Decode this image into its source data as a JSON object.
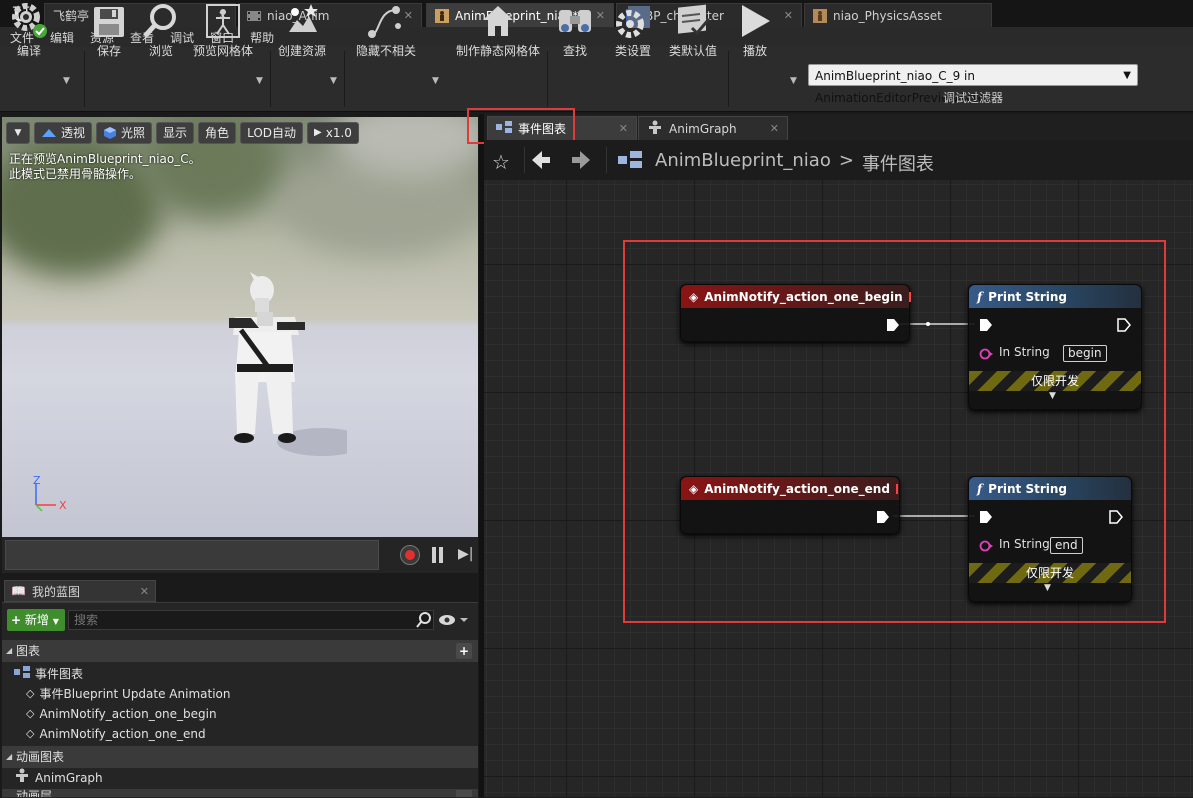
{
  "window_tabs": [
    {
      "label": "飞鹤亭"
    },
    {
      "label": "niao_Anim"
    },
    {
      "label": "AnimBlueprint_niao*"
    },
    {
      "label": "BP_character"
    },
    {
      "label": "niao_PhysicsAsset"
    }
  ],
  "menu": [
    "文件",
    "编辑",
    "资源",
    "查看",
    "调试",
    "窗口",
    "帮助"
  ],
  "toolbar": {
    "compile": "编译",
    "save": "保存",
    "browse": "浏览",
    "preview_mesh": "预览网格体",
    "create_asset": "创建资源",
    "hide_unrelated": "隐藏不相关",
    "make_static_mesh": "制作静态网格体",
    "find": "查找",
    "class_settings": "类设置",
    "class_defaults": "类默认值",
    "play": "播放",
    "debug_object": "AnimBlueprint_niao_C_9 in AnimationEditorPreviewActor",
    "debug_filter": "调试过滤器"
  },
  "viewport": {
    "perspective": "透视",
    "lit": "光照",
    "show": "显示",
    "character": "角色",
    "lod": "LOD自动",
    "speed": "x1.0",
    "msg_line1": "正在预览AnimBlueprint_niao_C。",
    "msg_line2": "此模式已禁用骨骼操作。",
    "axis_z": "Z",
    "axis_x": "X"
  },
  "my_blueprint": {
    "title": "我的蓝图",
    "new_label": "新增",
    "search_placeholder": "搜索",
    "graphs_section": "图表",
    "event_graph": "事件图表",
    "items": [
      "事件Blueprint Update Animation",
      "AnimNotify_action_one_begin",
      "AnimNotify_action_one_end"
    ],
    "anim_graphs_section": "动画图表",
    "anim_graph": "AnimGraph",
    "next_section_partial": "动画层"
  },
  "graph": {
    "tabs": [
      {
        "label": "事件图表"
      },
      {
        "label": "AnimGraph"
      }
    ],
    "breadcrumb_root": "AnimBlueprint_niao",
    "breadcrumb_sep": ">",
    "breadcrumb_current": "事件图表",
    "nodes": [
      {
        "event": "AnimNotify_action_one_begin",
        "func": "Print String",
        "pin_label": "In String",
        "value": "begin",
        "dev_only": "仅限开发"
      },
      {
        "event": "AnimNotify_action_one_end",
        "func": "Print String",
        "pin_label": "In String",
        "value": "end",
        "dev_only": "仅限开发"
      }
    ]
  },
  "colors": {
    "highlight": "#e23a3a",
    "event_header": "#8a1414",
    "function_header": "#385a8a",
    "new_button": "#3f8d2c"
  }
}
